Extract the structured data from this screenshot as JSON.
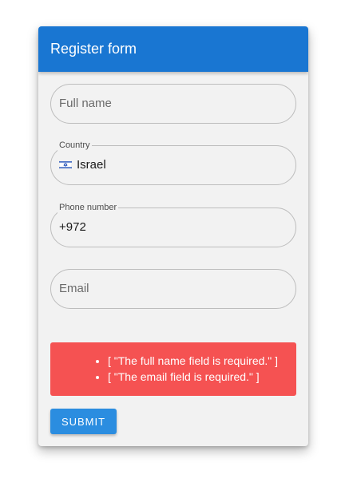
{
  "form": {
    "title": "Register form",
    "full_name": {
      "placeholder": "Full name",
      "value": ""
    },
    "country": {
      "label": "Country",
      "value": "Israel",
      "flag_icon": "israel-flag-icon"
    },
    "phone": {
      "label": "Phone number",
      "value": "+972"
    },
    "email": {
      "placeholder": "Email",
      "value": ""
    },
    "errors": [
      "[ \"The full name field is required.\" ]",
      "[ \"The email field is required.\" ]"
    ],
    "submit_label": "SUBMIT"
  },
  "colors": {
    "header_bg": "#1976d2",
    "error_bg": "#f55252",
    "button_bg": "#2b8de0",
    "card_bg": "#f2f2f2"
  }
}
